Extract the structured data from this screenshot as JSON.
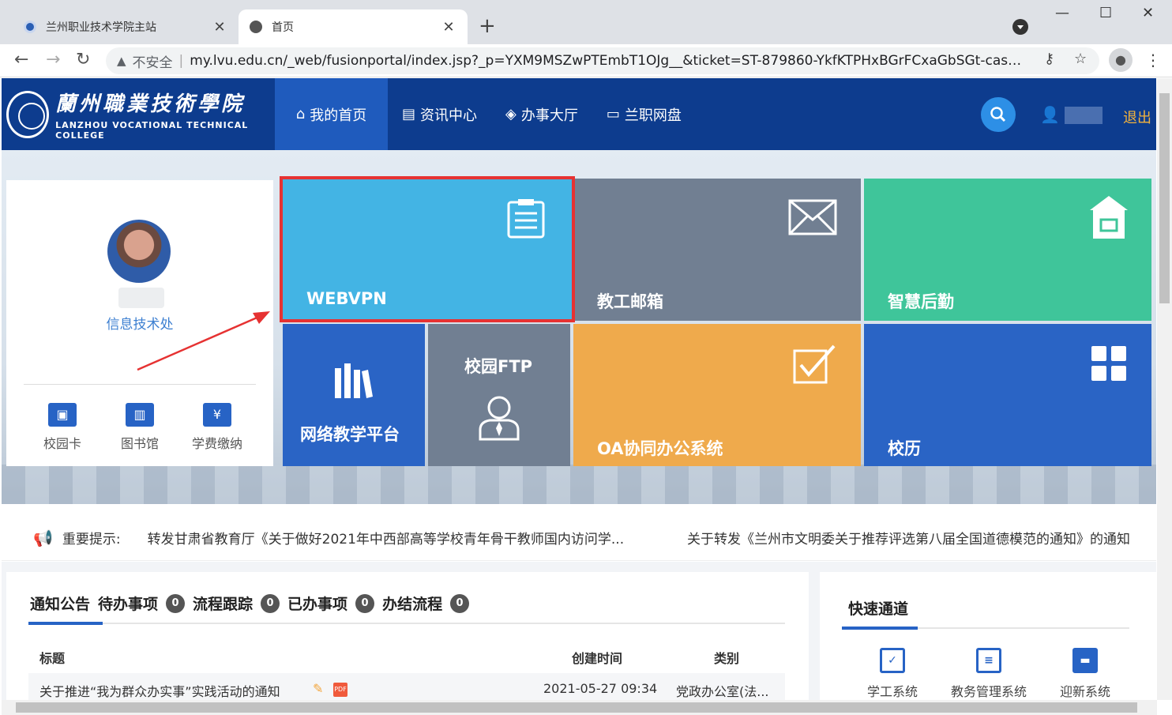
{
  "browser": {
    "tabs": [
      {
        "title": "兰州职业技术学院主站"
      },
      {
        "title": "首页"
      }
    ],
    "new_tab": "+",
    "address": {
      "warning": "▲",
      "insecure_label": "不安全",
      "separator": "|",
      "url": "my.lvu.edu.cn/_web/fusionportal/index.jsp?_p=YXM9MSZwPTEmbT1OJg__&ticket=ST-879860-YkfKTPHxBGrFCxaGbSGt-cas01.ex..."
    }
  },
  "header": {
    "logo_cn": "蘭州職業技術學院",
    "logo_en": "LANZHOU VOCATIONAL TECHNICAL COLLEGE",
    "nav": [
      {
        "label": "我的首页",
        "icon": "home-icon"
      },
      {
        "label": "资讯中心",
        "icon": "news-icon"
      },
      {
        "label": "办事大厅",
        "icon": "layers-icon"
      },
      {
        "label": "兰职网盘",
        "icon": "disk-icon"
      }
    ],
    "logout": "退出"
  },
  "profile": {
    "department": "信息技术处",
    "quick_links": [
      {
        "label": "校园卡",
        "icon": "id-card-icon"
      },
      {
        "label": "图书馆",
        "icon": "book-icon"
      },
      {
        "label": "学费缴纳",
        "icon": "payment-icon"
      }
    ]
  },
  "tiles": {
    "webvpn": "WEBVPN",
    "mail": "教工邮箱",
    "logistics": "智慧后勤",
    "teaching": "网络教学平台",
    "ftp": "校园FTP",
    "oa": "OA协同办公系统",
    "calendar": "校历"
  },
  "notice": {
    "label": "重要提示:",
    "items": [
      "转发甘肃省教育厅《关于做好2021年中西部高等学校青年骨干教师国内访问学...",
      "关于转发《兰州市文明委关于推荐评选第八届全国道德模范的通知》的通知"
    ]
  },
  "tasks": {
    "tabs": [
      {
        "label": "通知公告"
      },
      {
        "label": "待办事项",
        "count": "0"
      },
      {
        "label": "流程跟踪",
        "count": "0"
      },
      {
        "label": "已办事项",
        "count": "0"
      },
      {
        "label": "办结流程",
        "count": "0"
      }
    ],
    "columns": {
      "title": "标题",
      "created": "创建时间",
      "category": "类别"
    },
    "rows": [
      {
        "title": "关于推进“我为群众办实事”实践活动的通知",
        "created": "2021-05-27 09:34",
        "category": "党政办公室(法..."
      }
    ]
  },
  "quick_channel": {
    "title": "快速通道",
    "items": [
      {
        "label": "学工系统",
        "icon": "student-system-icon"
      },
      {
        "label": "教务管理系统",
        "icon": "academic-system-icon"
      },
      {
        "label": "迎新系统",
        "icon": "enrollment-system-icon"
      }
    ]
  },
  "colors": {
    "header_bg": "#0d3c8e",
    "webvpn": "#43b4e4",
    "gray_tile": "#717f92",
    "green_tile": "#3fc59a",
    "blue_tile": "#2a64c5",
    "orange_tile": "#efaa4c",
    "highlight": "#e63232"
  }
}
